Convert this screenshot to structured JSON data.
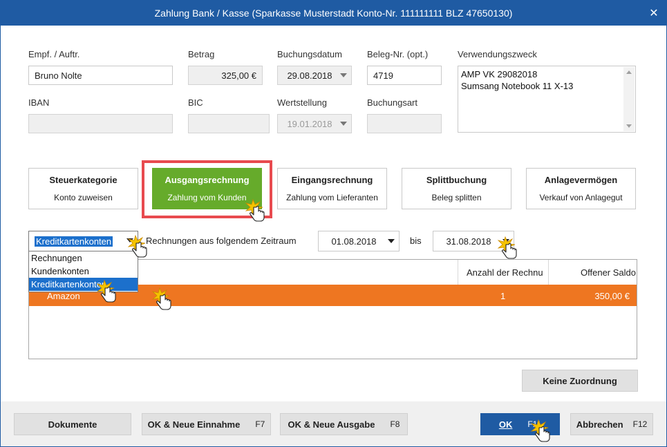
{
  "window": {
    "title": "Zahlung Bank / Kasse (Sparkasse Musterstadt Konto-Nr. 111111111  BLZ 47650130)",
    "close_glyph": "✕"
  },
  "form": {
    "empfaenger": {
      "label": "Empf. / Auftr.",
      "value": "Bruno Nolte"
    },
    "betrag": {
      "label": "Betrag",
      "value": "325,00 €"
    },
    "buchungsdatum": {
      "label": "Buchungsdatum",
      "value": "29.08.2018"
    },
    "beleg": {
      "label": "Beleg-Nr. (opt.)",
      "value": "4719"
    },
    "verwendungszweck": {
      "label": "Verwendungszweck",
      "line1": "AMP VK 29082018",
      "line2": "Sumsang Notebook 11 X-13"
    },
    "iban": {
      "label": "IBAN",
      "value": ""
    },
    "bic": {
      "label": "BIC",
      "value": ""
    },
    "wertstellung": {
      "label": "Wertstellung",
      "value": "19.01.2018"
    },
    "buchungsart": {
      "label": "Buchungsart",
      "value": ""
    }
  },
  "categories": [
    {
      "title": "Steuerkategorie",
      "subtitle": "Konto zuweisen"
    },
    {
      "title": "Ausgangsrechnung",
      "subtitle": "Zahlung vom Kunden"
    },
    {
      "title": "Eingangsrechnung",
      "subtitle": "Zahlung vom Lieferanten"
    },
    {
      "title": "Splittbuchung",
      "subtitle": "Beleg splitten"
    },
    {
      "title": "Anlagevermögen",
      "subtitle": "Verkauf von Anlagegut"
    }
  ],
  "filter": {
    "type_select": "Kreditkartenkonten",
    "range_label": "Rechnungen aus folgendem Zeitraum",
    "from_date": "01.08.2018",
    "to_label": "bis",
    "to_date": "31.08.2018"
  },
  "dropdown_options": [
    "Rechnungen",
    "Kundenkonten",
    "Kreditkartenkonten"
  ],
  "table": {
    "columns": [
      "",
      "Anzahl der Rechnu",
      "Offener Saldo"
    ],
    "rows": [
      {
        "name": "Amazon",
        "count": "1",
        "saldo": "350,00 €"
      }
    ]
  },
  "buttons": {
    "keine_zuordnung": "Keine Zuordnung",
    "dokumente": "Dokumente",
    "ok_neue_einnahme": "OK & Neue Einnahme",
    "ok_neue_einnahme_key": "F7",
    "ok_neue_ausgabe": "OK & Neue Ausgabe",
    "ok_neue_ausgabe_key": "F8",
    "ok": "OK",
    "ok_key": "F11",
    "abbrechen": "Abbrechen",
    "abbrechen_key": "F12"
  },
  "colors": {
    "titlebar": "#1f5ba3",
    "active_category": "#66ab2b",
    "highlight_frame": "#e84a4f",
    "selected_row": "#ee7621",
    "list_selection": "#1c70cc"
  },
  "icons": [
    "close-icon",
    "dropdown-arrow-icon",
    "scroll-up-icon",
    "scroll-down-icon",
    "hand-cursor-icon",
    "click-spark-icon"
  ]
}
